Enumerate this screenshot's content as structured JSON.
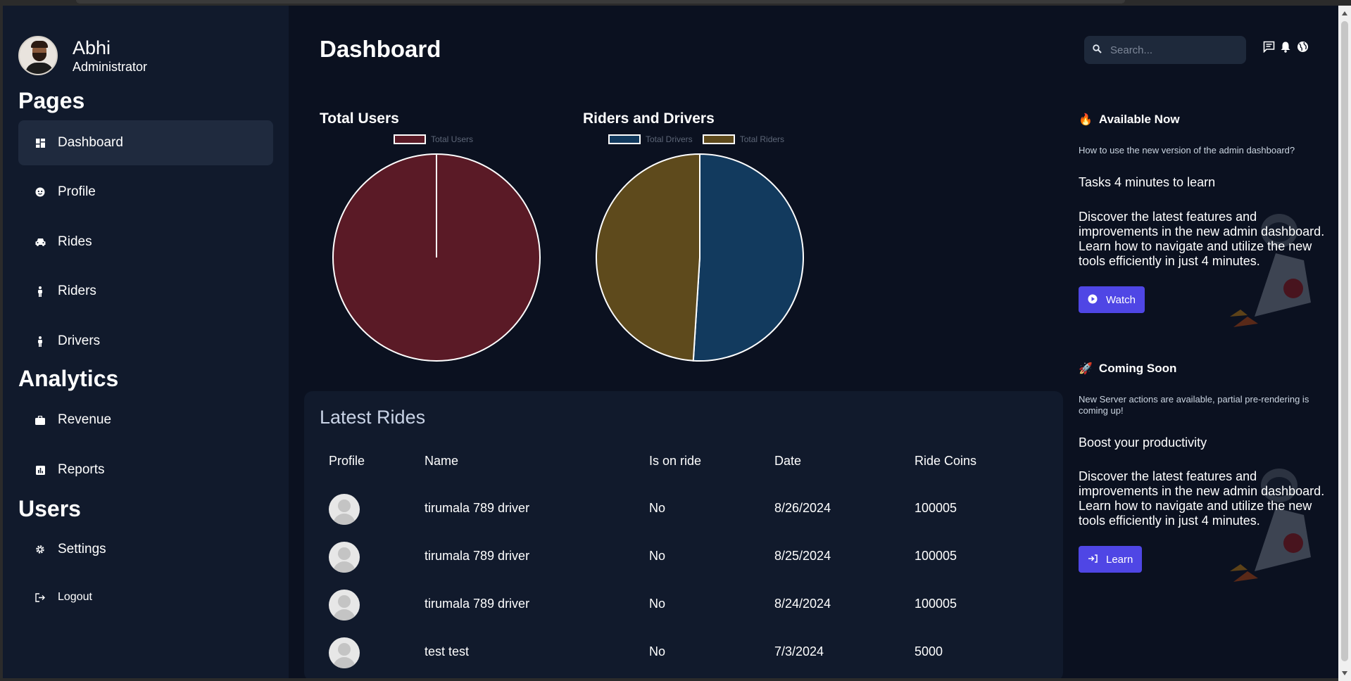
{
  "user": {
    "name": "Abhi",
    "role": "Administrator"
  },
  "sidebar": {
    "sections": [
      {
        "title": "Pages"
      },
      {
        "title": "Analytics"
      },
      {
        "title": "Users"
      }
    ],
    "items": [
      {
        "label": "Dashboard",
        "icon": "dashboard-icon"
      },
      {
        "label": "Profile",
        "icon": "face-icon"
      },
      {
        "label": "Rides",
        "icon": "car-icon"
      },
      {
        "label": "Riders",
        "icon": "person-icon"
      },
      {
        "label": "Drivers",
        "icon": "person-icon"
      },
      {
        "label": "Revenue",
        "icon": "briefcase-icon"
      },
      {
        "label": "Reports",
        "icon": "bar-chart-icon"
      },
      {
        "label": "Settings",
        "icon": "gear-icon"
      },
      {
        "label": "Logout",
        "icon": "logout-icon"
      }
    ]
  },
  "header": {
    "title": "Dashboard",
    "search_placeholder": "Search..."
  },
  "chart_data": [
    {
      "type": "pie",
      "title": "Total Users",
      "series": [
        {
          "name": "Total Users",
          "values": [
            1
          ]
        }
      ],
      "colors": [
        "#5a1a26"
      ],
      "legend_placement": "top"
    },
    {
      "type": "pie",
      "title": "Riders and Drivers",
      "categories": [
        "Total Drivers",
        "Total Riders"
      ],
      "values": [
        51,
        49
      ],
      "colors": [
        "#123a5e",
        "#5e4a1c"
      ],
      "legend_placement": "top"
    }
  ],
  "rides": {
    "title": "Latest Rides",
    "columns": [
      "Profile",
      "Name",
      "Is on ride",
      "Date",
      "Ride Coins"
    ],
    "rows": [
      {
        "name": "tirumala 789 driver",
        "on_ride": "No",
        "date": "8/26/2024",
        "coins": "100005"
      },
      {
        "name": "tirumala 789 driver",
        "on_ride": "No",
        "date": "8/25/2024",
        "coins": "100005"
      },
      {
        "name": "tirumala 789 driver",
        "on_ride": "No",
        "date": "8/24/2024",
        "coins": "100005"
      },
      {
        "name": "test test",
        "on_ride": "No",
        "date": "7/3/2024",
        "coins": "5000"
      }
    ]
  },
  "cards": [
    {
      "emoji": "🔥",
      "title": "Available Now",
      "question": "How to use the new version of the admin dashboard?",
      "subtitle": "Tasks 4 minutes to learn",
      "body": "Discover the latest features and improvements in the new admin dashboard. Learn how to navigate and utilize the new tools efficiently in just 4 minutes.",
      "button": "Watch",
      "button_icon": "play-icon"
    },
    {
      "emoji": "🚀",
      "title": "Coming Soon",
      "question": "New Server actions are available, partial pre-rendering is coming up!",
      "subtitle": "Boost your productivity",
      "body": "Discover the latest features and improvements in the new admin dashboard. Learn how to navigate and utilize the new tools efficiently in just 4 minutes.",
      "button": "Learn",
      "button_icon": "login-icon"
    }
  ],
  "colors": {
    "accent": "#4f46e5",
    "background": "#0b1120",
    "panel": "#111a2c"
  }
}
